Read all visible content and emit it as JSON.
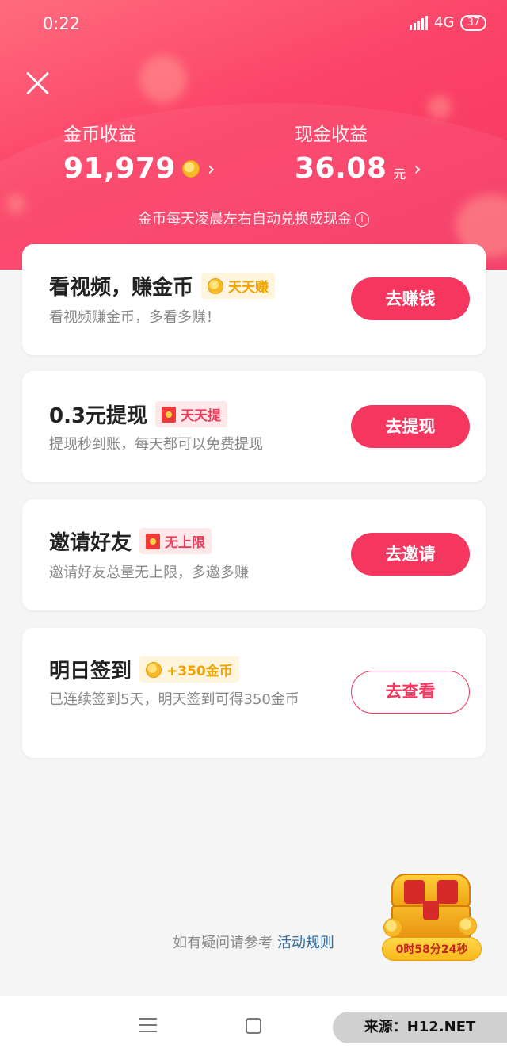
{
  "status_bar": {
    "time": "0:22",
    "network": "4G",
    "battery": "37"
  },
  "summary": {
    "coin_label": "金币收益",
    "coin_value": "91,979",
    "cash_label": "现金收益",
    "cash_value": "36.08",
    "cash_unit": "元",
    "exchange_note": "金币每天凌晨左右自动兑换成现金",
    "info_glyph": "i"
  },
  "tasks": [
    {
      "title": "看视频，赚金币",
      "badge": "天天赚",
      "badge_icon": "coin-icon",
      "subtitle": "看视频赚金币，多看多赚！",
      "button": "去赚钱"
    },
    {
      "title": "0.3元提现",
      "badge": "天天提",
      "badge_icon": "red-envelope-icon",
      "subtitle": "提现秒到账，每天都可以免费提现",
      "button": "去提现"
    },
    {
      "title": "邀请好友",
      "badge": "无上限",
      "badge_icon": "red-envelope-icon",
      "subtitle": "邀请好友总量无上限，多邀多赚",
      "button": "去邀请"
    },
    {
      "title": "明日签到",
      "badge": "+350金币",
      "badge_icon": "coin-icon",
      "subtitle": "已连续签到5天，明天签到可得350金币",
      "button": "去查看"
    }
  ],
  "footer": {
    "question_text": "如有疑问请参考",
    "rules_link": "活动规则"
  },
  "treasure": {
    "timer": "0时58分24秒"
  },
  "watermark": "来源：H12.NET",
  "colors": {
    "accent": "#f5365f",
    "gold": "#f0a300"
  }
}
